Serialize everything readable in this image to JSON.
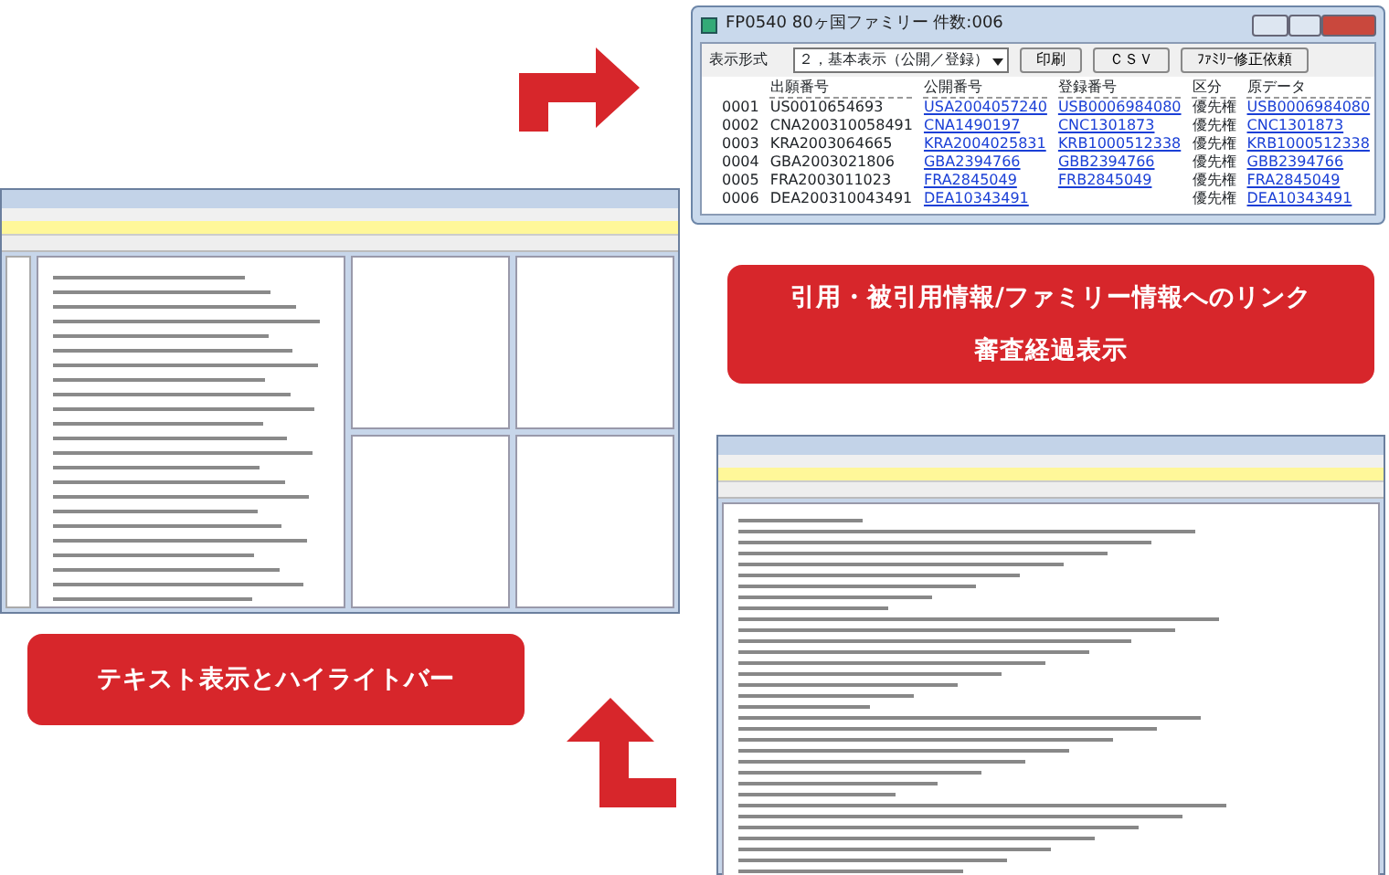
{
  "family_window": {
    "title": "FP0540 80ヶ国ファミリー 件数:006",
    "display_label": "表示形式",
    "display_select": "２，基本表示（公開／登録）",
    "buttons": [
      "印刷",
      "ＣＳＶ",
      "ﾌｧﾐﾘｰ修正依頼"
    ],
    "columns": [
      "出願番号",
      "公開番号",
      "登録番号",
      "区分",
      "原データ"
    ],
    "rows": [
      {
        "no": "0001",
        "application": "US0010654693",
        "publication": "USA2004057240",
        "registration": "USB0006984080",
        "category": "優先権",
        "original": "USB0006984080"
      },
      {
        "no": "0002",
        "application": "CNA200310058491",
        "publication": "CNA1490197",
        "registration": "CNC1301873",
        "category": "優先権",
        "original": "CNC1301873"
      },
      {
        "no": "0003",
        "application": "KRA2003064665",
        "publication": "KRA2004025831",
        "registration": "KRB1000512338",
        "category": "優先権",
        "original": "KRB1000512338"
      },
      {
        "no": "0004",
        "application": "GBA2003021806",
        "publication": "GBA2394766",
        "registration": "GBB2394766",
        "category": "優先権",
        "original": "GBB2394766"
      },
      {
        "no": "0005",
        "application": "FRA2003011023",
        "publication": "FRA2845049",
        "registration": "FRB2845049",
        "category": "優先権",
        "original": "FRA2845049"
      },
      {
        "no": "0006",
        "application": "DEA200310043491",
        "publication": "DEA10343491",
        "category": "優先権",
        "original": "DEA10343491"
      }
    ]
  },
  "captions": [
    {
      "lines": [
        "引用・被引用情報/ファミリー情報へのリンク",
        "審査経過表示"
      ]
    },
    {
      "lines": [
        "テキスト表示とハイライトバー"
      ]
    }
  ]
}
